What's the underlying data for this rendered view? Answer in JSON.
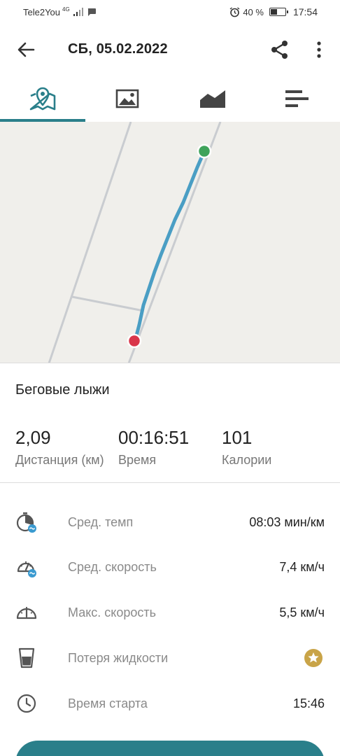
{
  "status_bar": {
    "carrier": "Tele2You",
    "network": "4G",
    "battery": "40 %",
    "battery_level": 0.4,
    "time": "17:54"
  },
  "app_bar": {
    "title": "СБ, 05.02.2022",
    "back_icon": "arrow-back-icon",
    "share_icon": "share-icon",
    "more_icon": "more-vertical-icon"
  },
  "tabs": [
    {
      "icon": "map-icon",
      "active": true
    },
    {
      "icon": "image-icon",
      "active": false
    },
    {
      "icon": "chart-icon",
      "active": false
    },
    {
      "icon": "details-icon",
      "active": false
    }
  ],
  "colors": {
    "accent": "#2a7f8a",
    "route": "#4a9ec4",
    "start_marker": "#3fa35a",
    "end_marker": "#d9364a",
    "premium": "#c9a448"
  },
  "activity": {
    "name": "Беговые лыжи"
  },
  "stats": [
    {
      "value": "2,09",
      "label": "Дистанция (км)"
    },
    {
      "value": "00:16:51",
      "label": "Время"
    },
    {
      "value": "101",
      "label": "Калории"
    }
  ],
  "metrics": [
    {
      "icon": "pace-icon",
      "label": "Сред. темп",
      "value": "08:03 мин/км"
    },
    {
      "icon": "avg-speed-icon",
      "label": "Сред. скорость",
      "value": "7,4 км/ч"
    },
    {
      "icon": "max-speed-icon",
      "label": "Макс. скорость",
      "value": "5,5 км/ч"
    },
    {
      "icon": "glass-icon",
      "label": "Потеря жидкости",
      "value": "",
      "premium_icon": "star-badge-icon"
    },
    {
      "icon": "clock-icon",
      "label": "Время старта",
      "value": "15:46"
    }
  ]
}
